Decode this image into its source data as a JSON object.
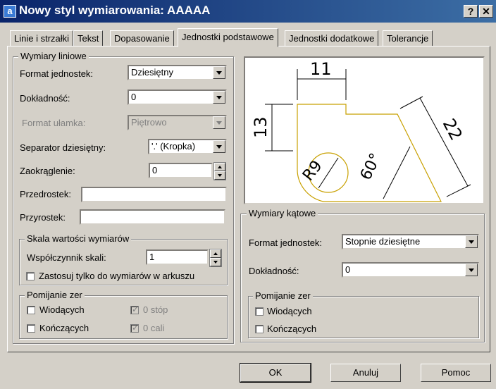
{
  "window": {
    "title": "Nowy styl wymiarowania: AAAAA",
    "icon": "autocad-icon",
    "help": "?",
    "close": "✕"
  },
  "tabs": [
    {
      "label": "Linie i strzałki"
    },
    {
      "label": "Tekst"
    },
    {
      "label": "Dopasowanie"
    },
    {
      "label": "Jednostki podstawowe",
      "active": true
    },
    {
      "label": "Jednostki dodatkowe"
    },
    {
      "label": "Tolerancje"
    }
  ],
  "linear": {
    "group_label": "Wymiary liniowe",
    "unit_format_label": "Format jednostek:",
    "unit_format_value": "Dziesiętny",
    "precision_label": "Dokładność:",
    "precision_value": "0",
    "fraction_format_label": "Format ułamka:",
    "fraction_format_value": "Piętrowo",
    "decimal_sep_label": "Separator dziesiętny:",
    "decimal_sep_value": "'.' (Kropka)",
    "round_label": "Zaokrąglenie:",
    "round_value": "0",
    "prefix_label": "Przedrostek:",
    "prefix_value": "",
    "suffix_label": "Przyrostek:",
    "suffix_value": ""
  },
  "scale": {
    "group_label": "Skala wartości wymiarów",
    "factor_label": "Współczynnik skali:",
    "factor_value": "1",
    "layout_only_label": "Zastosuj tylko do wymiarów w arkuszu"
  },
  "zero_linear": {
    "group_label": "Pomijanie zer",
    "leading": "Wiodących",
    "trailing": "Kończących",
    "feet": "0 stóp",
    "inches": "0 cali"
  },
  "angular": {
    "group_label": "Wymiary kątowe",
    "unit_format_label": "Format jednostek:",
    "unit_format_value": "Stopnie dziesiętne",
    "precision_label": "Dokładność:",
    "precision_value": "0"
  },
  "zero_angular": {
    "group_label": "Pomijanie zer",
    "leading": "Wiodących",
    "trailing": "Kończących"
  },
  "preview": {
    "dim_11": "11",
    "dim_13": "13",
    "dim_r9": "R9",
    "dim_60": "60°",
    "dim_22": "22",
    "color_shape": "#c8a000"
  },
  "buttons": {
    "ok": "OK",
    "cancel": "Anuluj",
    "help": "Pomoc"
  }
}
